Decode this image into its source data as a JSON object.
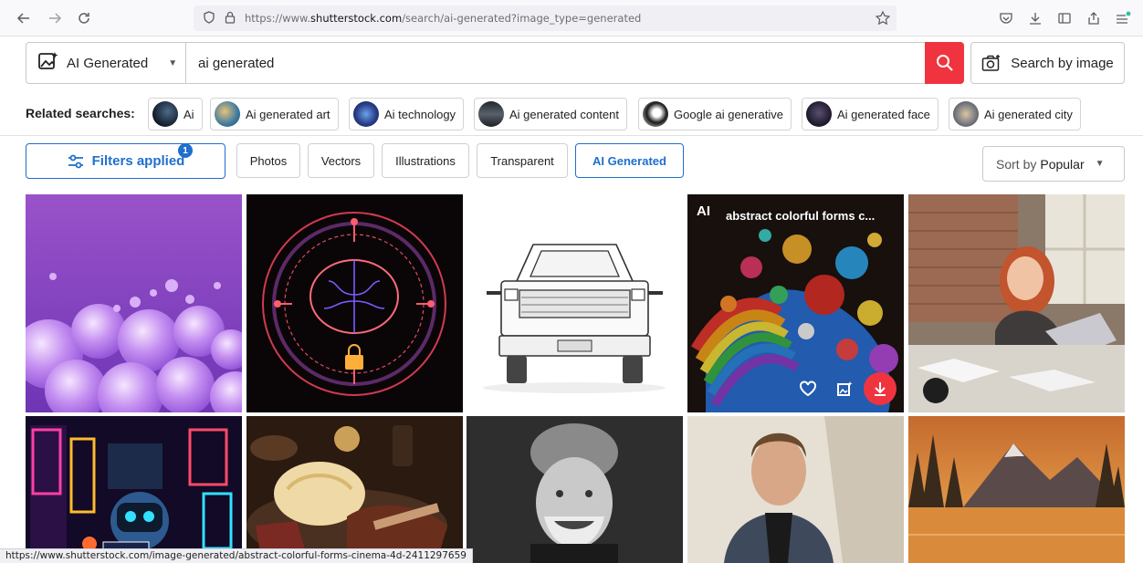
{
  "browser": {
    "url_prefix": "https://www.",
    "url_domain": "shutterstock.com",
    "url_path": "/search/ai-generated?image_type=generated",
    "status_url": "https://www.shutterstock.com/image-generated/abstract-colorful-forms-cinema-4d-2411297659"
  },
  "search": {
    "type_label": "AI Generated",
    "query": "ai generated",
    "search_by_image_label": "Search by image"
  },
  "related": {
    "label": "Related searches:",
    "chips": [
      {
        "label": "Ai"
      },
      {
        "label": "Ai generated art"
      },
      {
        "label": "Ai technology"
      },
      {
        "label": "Ai generated content"
      },
      {
        "label": "Google ai generative"
      },
      {
        "label": "Ai generated face"
      },
      {
        "label": "Ai generated city"
      }
    ]
  },
  "filters": {
    "applied_label": "Filters applied",
    "applied_count": "1",
    "tabs": [
      {
        "label": "Photos"
      },
      {
        "label": "Vectors"
      },
      {
        "label": "Illustrations"
      },
      {
        "label": "Transparent"
      },
      {
        "label": "AI Generated"
      }
    ],
    "sort_prefix": "Sort by",
    "sort_value": "Popular"
  },
  "grid": {
    "hover_badge": "AI",
    "hover_title": "abstract colorful forms c..."
  },
  "colors": {
    "brand_red": "#f0343f",
    "accent_blue": "#1f6fcc"
  }
}
